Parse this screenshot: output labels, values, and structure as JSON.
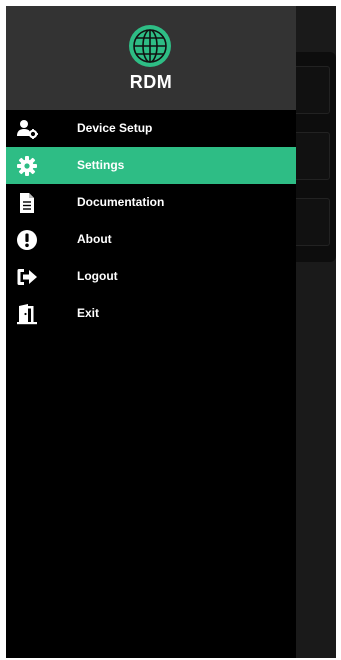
{
  "app": {
    "logo_text": "RDM",
    "accent_color": "#2ebd85"
  },
  "menu": {
    "items": [
      {
        "label": "Device Setup",
        "icon": "user-gear-icon",
        "active": false
      },
      {
        "label": "Settings",
        "icon": "gear-icon",
        "active": true
      },
      {
        "label": "Documentation",
        "icon": "document-icon",
        "active": false
      },
      {
        "label": "About",
        "icon": "exclamation-circle-icon",
        "active": false
      },
      {
        "label": "Logout",
        "icon": "logout-arrow-icon",
        "active": false
      },
      {
        "label": "Exit",
        "icon": "exit-door-icon",
        "active": false
      }
    ]
  }
}
